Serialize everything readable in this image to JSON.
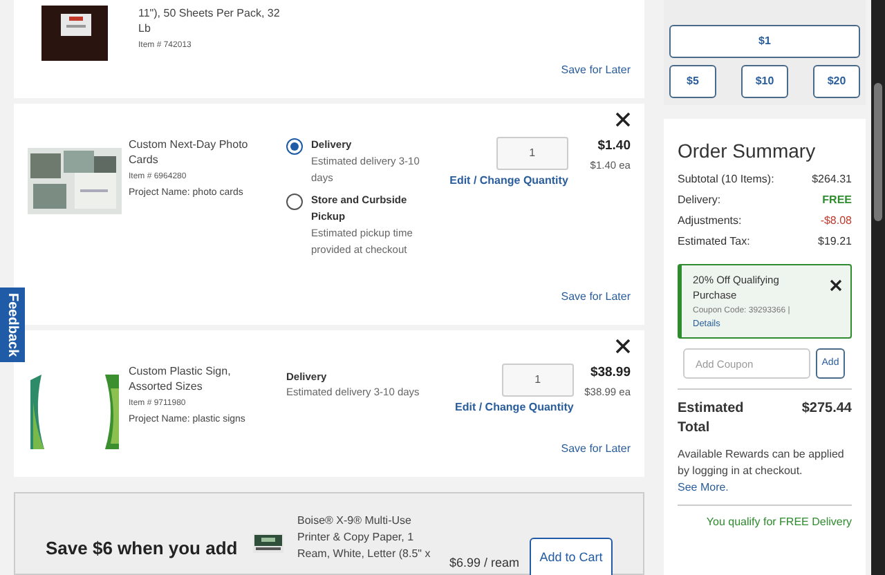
{
  "cart_items": [
    {
      "kind": "partial",
      "title": "11\"), 50 Sheets Per Pack, 32 Lb",
      "item_number": "Item # 742013",
      "save_link": "Save for Later"
    },
    {
      "kind": "options",
      "title": "Custom Next-Day Photo Cards",
      "item_number": "Item # 6964280",
      "project": "Project Name: photo cards",
      "options": [
        {
          "label": "Delivery",
          "detail": "Estimated delivery 3-10 days",
          "selected": true
        },
        {
          "label": "Store and Curbside Pickup",
          "detail": "Estimated pickup time provided at checkout",
          "selected": false
        }
      ],
      "quantity": "1",
      "edit_link": "Edit / Change Quantity",
      "price": "$1.40",
      "unit_price": "$1.40 ea",
      "save_link": "Save for Later"
    },
    {
      "kind": "single",
      "title": "Custom Plastic Sign, Assorted Sizes",
      "item_number": "Item # 9711980",
      "project": "Project Name: plastic signs",
      "delivery_label": "Delivery",
      "delivery_detail": "Estimated delivery 3-10 days",
      "quantity": "1",
      "edit_link": "Edit / Change Quantity",
      "price": "$38.99",
      "unit_price": "$38.99 ea",
      "save_link": "Save for Later"
    }
  ],
  "promo": {
    "headline": "Save $6 when you add",
    "product": "Boise® X-9® Multi-Use Printer & Copy Paper, 1 Ream, White, Letter (8.5\" x",
    "price": "$6.99 / ream",
    "button": "Add to Cart"
  },
  "feedback_tab": "Feedback",
  "donation": {
    "amounts": [
      "$1",
      "$5",
      "$10",
      "$20"
    ]
  },
  "order_summary": {
    "title": "Order Summary",
    "rows": [
      {
        "label": "Subtotal (10 Items):",
        "value": "$264.31",
        "kind": "normal"
      },
      {
        "label": "Delivery:",
        "value": "FREE",
        "kind": "free"
      },
      {
        "label": "Adjustments:",
        "value": "-$8.08",
        "kind": "discount"
      },
      {
        "label": "Estimated Tax:",
        "value": "$19.21",
        "kind": "normal"
      }
    ],
    "coupon": {
      "title": "20% Off Qualifying Purchase",
      "code": "Coupon Code: 39293366 |",
      "details_link": "Details"
    },
    "coupon_field": {
      "placeholder": "Add Coupon",
      "button": "Add"
    },
    "total_label": "Estimated Total",
    "total_value": "$275.44",
    "rewards_text": "Available Rewards can be applied by logging in at checkout.",
    "rewards_link": "See More.",
    "free_delivery": "You qualify for FREE Delivery"
  }
}
